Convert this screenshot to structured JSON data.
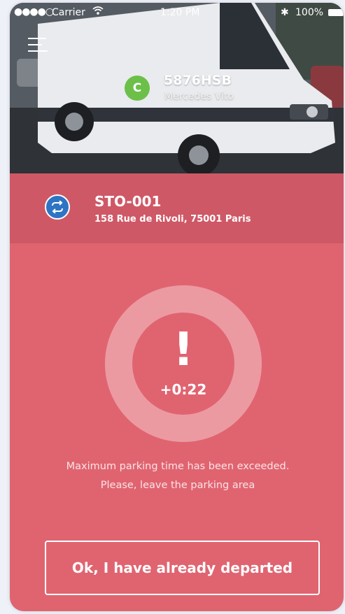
{
  "status_bar": {
    "signal": "●●●●○",
    "carrier": "Carrier",
    "time": "1:20 PM",
    "battery": "100%"
  },
  "vehicle": {
    "badge": "C",
    "plate": "5876HSB",
    "model": "Mercedes Vito"
  },
  "station": {
    "code": "STO-001",
    "address": "158 Rue de Rivoli, 75001 Paris"
  },
  "timer": {
    "alert_symbol": "!",
    "overtime": "+0:22"
  },
  "message": "Maximum parking time has been exceeded. Please, leave the parking area",
  "actions": {
    "depart_label": "Ok, I have already departed"
  },
  "colors": {
    "background": "#e06470",
    "station_bar": "#cf5866",
    "ring": "#ec9aa2",
    "vehicle_badge": "#6cc04a",
    "station_icon": "#2e74c4"
  }
}
